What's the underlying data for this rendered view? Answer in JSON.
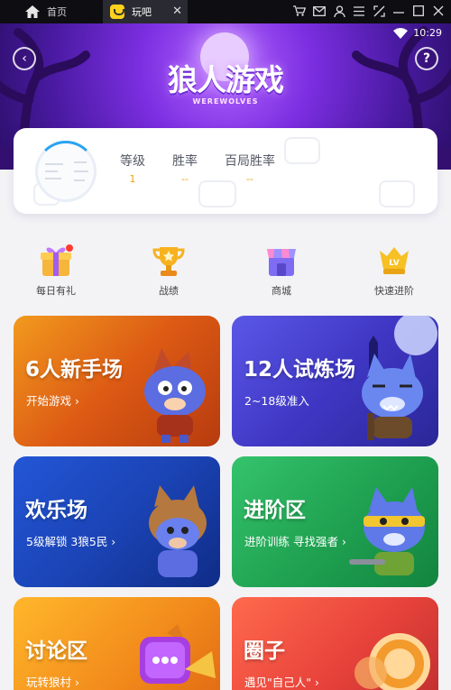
{
  "window": {
    "home_label": "首页",
    "tab_label": "玩吧",
    "close_glyph": "✕",
    "icons": [
      "cart-icon",
      "mail-icon",
      "user-icon",
      "menu-icon",
      "screenshot-icon",
      "minimize-icon",
      "maximize-icon",
      "window-close-icon"
    ]
  },
  "status_bar": {
    "time": "10:29"
  },
  "banner": {
    "title": "狼人游戏",
    "subtitle": "WEREWOLVES",
    "back_glyph": "‹",
    "help_glyph": "?"
  },
  "profile": {
    "stats": [
      {
        "label": "等级",
        "value": "1"
      },
      {
        "label": "胜率",
        "value": "--"
      },
      {
        "label": "百局胜率",
        "value": "--"
      }
    ]
  },
  "quick_menu": [
    {
      "label": "每日有礼",
      "icon": "gift-icon"
    },
    {
      "label": "战绩",
      "icon": "trophy-icon"
    },
    {
      "label": "商城",
      "icon": "store-icon"
    },
    {
      "label": "快速进阶",
      "icon": "level-up-icon"
    }
  ],
  "modes": [
    {
      "title": "6人新手场",
      "subtitle": "开始游戏 ›"
    },
    {
      "title": "12人试炼场",
      "subtitle": "2~18级准入"
    },
    {
      "title": "欢乐场",
      "subtitle": "5级解锁 3狼5民 ›"
    },
    {
      "title": "进阶区",
      "subtitle": "进阶训练 寻找强者 ›"
    },
    {
      "title": "讨论区",
      "subtitle": "玩转狼村 ›"
    },
    {
      "title": "圈子",
      "subtitle": "遇见\"自己人\" ›"
    }
  ],
  "colors": {
    "accent": "#7b2ee0",
    "stat_value": "#f0a10d",
    "gift_dot": "#ff3b30"
  }
}
